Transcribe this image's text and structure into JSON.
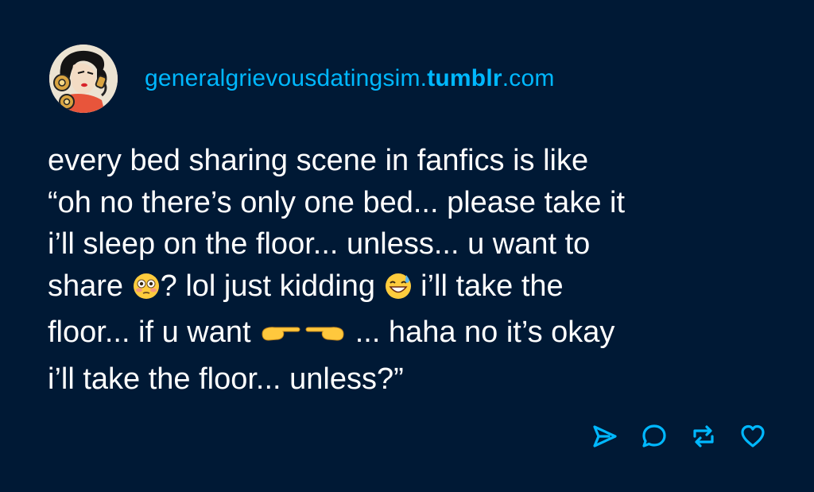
{
  "post": {
    "blog": {
      "name_regular_1": "generalgrievousdatingsim.",
      "name_bold": "tumblr",
      "name_regular_2": ".com",
      "color": "#00b8ff"
    },
    "avatar_icon": "woman-on-telephone-illustration",
    "text_lines": [
      [
        "every bed sharing scene in fanfics is like"
      ],
      [
        "“oh no there’s only one bed... please take it"
      ],
      [
        "i’ll sleep on the floor... unless... u want to"
      ],
      [
        "share ",
        "? lol just kidding ",
        " i’ll take the"
      ],
      [
        "floor... if u want ",
        " ... haha no it’s okay"
      ],
      [
        "i’ll take the floor... unless?”"
      ]
    ],
    "emojis": [
      "flushed-face-emoji",
      "grinning-face-with-sweat-emoji",
      "pointing-fingers-emoji"
    ],
    "actions": [
      {
        "name": "share-button",
        "icon": "paper-plane-icon"
      },
      {
        "name": "reply-button",
        "icon": "speech-bubble-icon"
      },
      {
        "name": "reblog-button",
        "icon": "reblog-arrows-icon"
      },
      {
        "name": "like-button",
        "icon": "heart-icon"
      }
    ],
    "colors": {
      "background": "#001935",
      "text": "#ffffff",
      "accent": "#00b8ff"
    }
  }
}
